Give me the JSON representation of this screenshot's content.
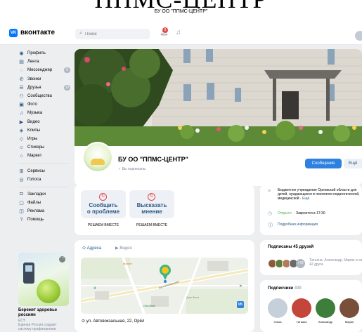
{
  "overlay_title": "ППМС-ЦЕНТР",
  "tab_title": "БУ ОО \"ППМС-ЦЕНТР\"",
  "header": {
    "logo_mark": "VK",
    "app_name": "вконтакте",
    "search_placeholder": "Поиск",
    "notifications_badge": "9"
  },
  "sidebar": {
    "items": [
      {
        "label": "Профиль",
        "icon": "user-icon"
      },
      {
        "label": "Лента",
        "icon": "news-icon"
      },
      {
        "label": "Мессенджер",
        "icon": "message-icon",
        "count": "9"
      },
      {
        "label": "Звонки",
        "icon": "phone-icon"
      },
      {
        "label": "Друзья",
        "icon": "friends-icon",
        "count": "10"
      },
      {
        "label": "Сообщества",
        "icon": "groups-icon"
      },
      {
        "label": "Фото",
        "icon": "photo-icon"
      },
      {
        "label": "Музыка",
        "icon": "music-icon"
      },
      {
        "label": "Видео",
        "icon": "video-icon"
      },
      {
        "label": "Клипы",
        "icon": "clips-icon"
      },
      {
        "label": "Игры",
        "icon": "games-icon"
      },
      {
        "label": "Стикеры",
        "icon": "stickers-icon"
      },
      {
        "label": "Маркет",
        "icon": "market-icon"
      }
    ],
    "items2": [
      {
        "label": "Сервисы",
        "icon": "services-icon"
      },
      {
        "label": "Голоса",
        "icon": "votes-icon"
      }
    ],
    "items3": [
      {
        "label": "Закладки",
        "icon": "bookmark-icon"
      },
      {
        "label": "Файлы",
        "icon": "file-icon"
      },
      {
        "label": "Реклама",
        "icon": "ads-icon"
      },
      {
        "label": "Помощь",
        "icon": "help-icon"
      }
    ]
  },
  "promo": {
    "title": "Бережет здоровье россиян",
    "sub1": "ЕГЭ",
    "sub2": "Единая Россия создает систему профилактики"
  },
  "group": {
    "name": "БУ ОО \"ППМС-ЦЕНТР\"",
    "subscription": "Вы подписаны",
    "message_button": "Сообщение",
    "more_button": "Ещё"
  },
  "actions": [
    {
      "label_line1": "Сообщить",
      "label_line2": "о проблеме",
      "caption": "РЕШАЕМ ВМЕСТЕ"
    },
    {
      "label_line1": "Высказать",
      "label_line2": "мнение",
      "caption": "РЕШАЕМ ВМЕСТЕ"
    }
  ],
  "info": {
    "description": "Бюджетное учреждение Орловской области для детей, нуждающихся в психолого-педагогической, медицинской",
    "more": "Ещё",
    "open_status": "Открыто",
    "close_time": "· Закроется в 17:30",
    "details_link": "Подробная информация"
  },
  "map": {
    "tab_address": "Адреса",
    "tab_video": "Видео",
    "street_label": "Автовокзальная",
    "address": "ул. Автовокзальная, 22, Орёл",
    "place_label": "Сбербанк"
  },
  "friends": {
    "title": "Подписаны 45 друзей",
    "more_count": "+42",
    "names": "Татьяна, Александр, Мария и ещё 42 друга"
  },
  "subscribers": {
    "title": "Подписчики",
    "count": "499",
    "people": [
      {
        "name": "Ольга",
        "color": "#c5d0db"
      },
      {
        "name": "Татьяна",
        "color": "#c4463a"
      },
      {
        "name": "Александр",
        "color": "#3d7f3a"
      },
      {
        "name": "Марин",
        "color": "#7a4f3a"
      }
    ]
  },
  "colors": {
    "accent": "#2d81e0",
    "link": "#2a5885",
    "open_green": "#4bb34b",
    "background": "#edeef0"
  }
}
